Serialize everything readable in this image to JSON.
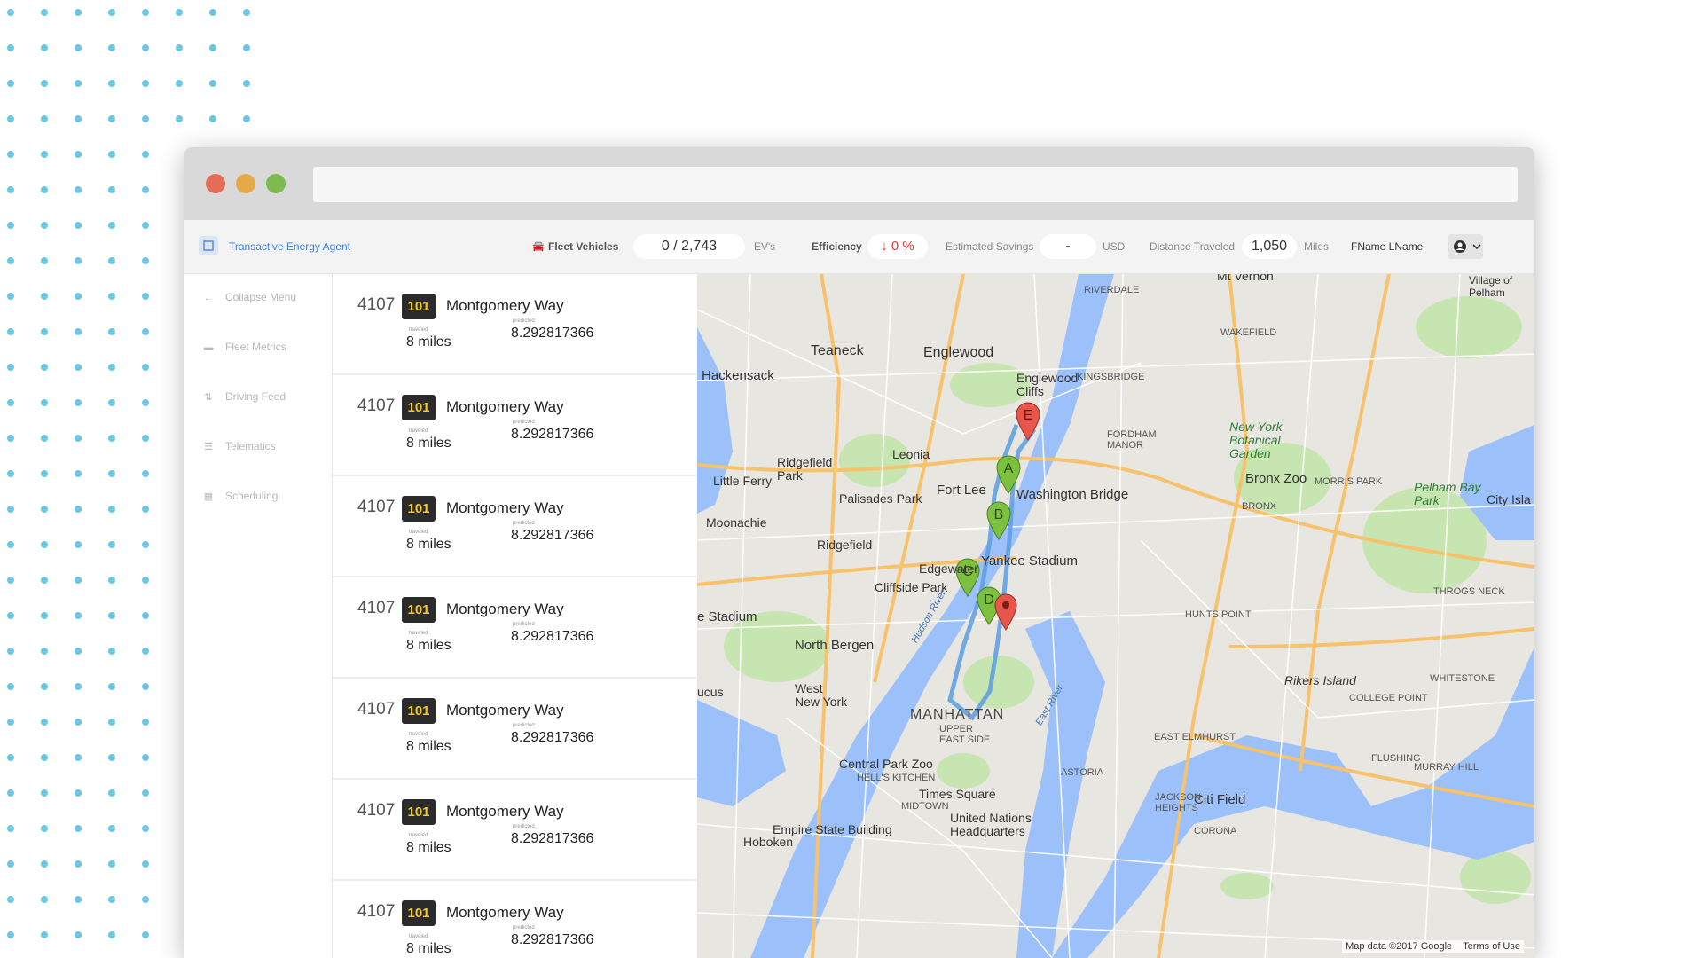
{
  "app": {
    "brand_name": "Transactive Energy Agent",
    "fleet_vehicles_label": "Fleet Vehicles",
    "fleet_vehicles_value": "0 / 2,743",
    "fleet_vehicles_unit": "EV's",
    "efficiency_label": "Efficiency",
    "efficiency_value": "↓ 0 %",
    "savings_label": "Estimated Savings",
    "savings_value": "-",
    "savings_unit": "USD",
    "distance_label": "Distance Traveled",
    "distance_value": "1,050",
    "distance_unit": "Miles",
    "user_name": "FName LName",
    "colors": {
      "accent": "#3b82d6",
      "danger": "#e03b3b",
      "badge_text": "#f5cc1f"
    }
  },
  "sidebar": {
    "items": [
      {
        "label": "Collapse Menu",
        "icon": "arrow-left-icon"
      },
      {
        "label": "Fleet Metrics",
        "icon": "car-icon"
      },
      {
        "label": "Driving Feed",
        "icon": "sort-icon"
      },
      {
        "label": "Telematics",
        "icon": "sliders-icon"
      },
      {
        "label": "Scheduling",
        "icon": "calendar-icon"
      }
    ]
  },
  "trips": [
    {
      "id": "4107",
      "badge": "101",
      "street": "Montgomery Way",
      "traveled_caption": "traveled",
      "miles": "8 miles",
      "predicted_caption": "predicted",
      "predicted": "8.292817366"
    },
    {
      "id": "4107",
      "badge": "101",
      "street": "Montgomery Way",
      "traveled_caption": "traveled",
      "miles": "8 miles",
      "predicted_caption": "predicted",
      "predicted": "8.292817366"
    },
    {
      "id": "4107",
      "badge": "101",
      "street": "Montgomery Way",
      "traveled_caption": "traveled",
      "miles": "8 miles",
      "predicted_caption": "predicted",
      "predicted": "8.292817366"
    },
    {
      "id": "4107",
      "badge": "101",
      "street": "Montgomery Way",
      "traveled_caption": "traveled",
      "miles": "8 miles",
      "predicted_caption": "predicted",
      "predicted": "8.292817366"
    },
    {
      "id": "4107",
      "badge": "101",
      "street": "Montgomery Way",
      "traveled_caption": "traveled",
      "miles": "8 miles",
      "predicted_caption": "predicted",
      "predicted": "8.292817366"
    },
    {
      "id": "4107",
      "badge": "101",
      "street": "Montgomery Way",
      "traveled_caption": "traveled",
      "miles": "8 miles",
      "predicted_caption": "predicted",
      "predicted": "8.292817366"
    },
    {
      "id": "4107",
      "badge": "101",
      "street": "Montgomery Way",
      "traveled_caption": "traveled",
      "miles": "8 miles",
      "predicted_caption": "predicted",
      "predicted": "8.292817366"
    }
  ],
  "map": {
    "markers": [
      "A",
      "B",
      "C",
      "D",
      "E"
    ],
    "labels": {
      "teaneck": "Teaneck",
      "englewood": "Englewood",
      "englewood_cliffs": "Englewood Cliffs",
      "hackensack": "Hackensack",
      "leonia": "Leonia",
      "ridgefield_park": "Ridgefield Park",
      "little_ferry": "Little Ferry",
      "palisades_park": "Palisades Park",
      "fort_lee": "Fort Lee",
      "moonachie": "Moonachie",
      "ridgefield": "Ridgefield",
      "edgewater": "Edgewater",
      "cliffside_park": "Cliffside Park",
      "north_bergen": "North Bergen",
      "west_new_york": "West New York",
      "manhattan": "MANHATTAN",
      "washington_bridge": "Washington Bridge",
      "yankee_stadium": "Yankee Stadium",
      "bronx_zoo": "Bronx Zoo",
      "ny_botanical_garden": "New York Botanical Garden",
      "pelham_bay_park": "Pelham Bay Park",
      "rikers_island": "Rikers Island",
      "central_park_zoo": "Central Park Zoo",
      "times_square": "Times Square",
      "empire_state": "Empire State Building",
      "united_nations": "United Nations Headquarters",
      "citi_field": "Citi Field",
      "hoboken": "Hoboken",
      "riverdale": "RIVERDALE",
      "mount_vernon": "Mt Vernon",
      "pelham": "Village of Pelham",
      "city_island": "City Isla",
      "kingsbridge": "KINGSBRIDGE",
      "fordham_manor": "FORDHAM MANOR",
      "wakefield": "WAKEFIELD",
      "throgs_neck": "THROGS NECK",
      "astoria": "ASTORIA",
      "east_elmhurst": "EAST ELMHURST",
      "flushing": "FLUSHING",
      "corona": "CORONA",
      "upper_east_side": "UPPER EAST SIDE",
      "hells_kitchen": "HELL'S KITCHEN",
      "midtown": "MIDTOWN",
      "hunts_point": "HUNTS POINT",
      "whitestone": "WHITESTONE",
      "college_point": "COLLEGE POINT",
      "bronx": "BRONX",
      "morris_park": "MORRIS PARK",
      "jackson_heights": "JACKSON HEIGHTS",
      "murray_hill": "MURRAY HILL",
      "stadium_left": "e Stadium",
      "lucus": "ucus",
      "hudson_river": "Hudson River",
      "east_river": "East River"
    },
    "attribution": "Map data ©2017 Google",
    "terms": "Terms of Use"
  }
}
